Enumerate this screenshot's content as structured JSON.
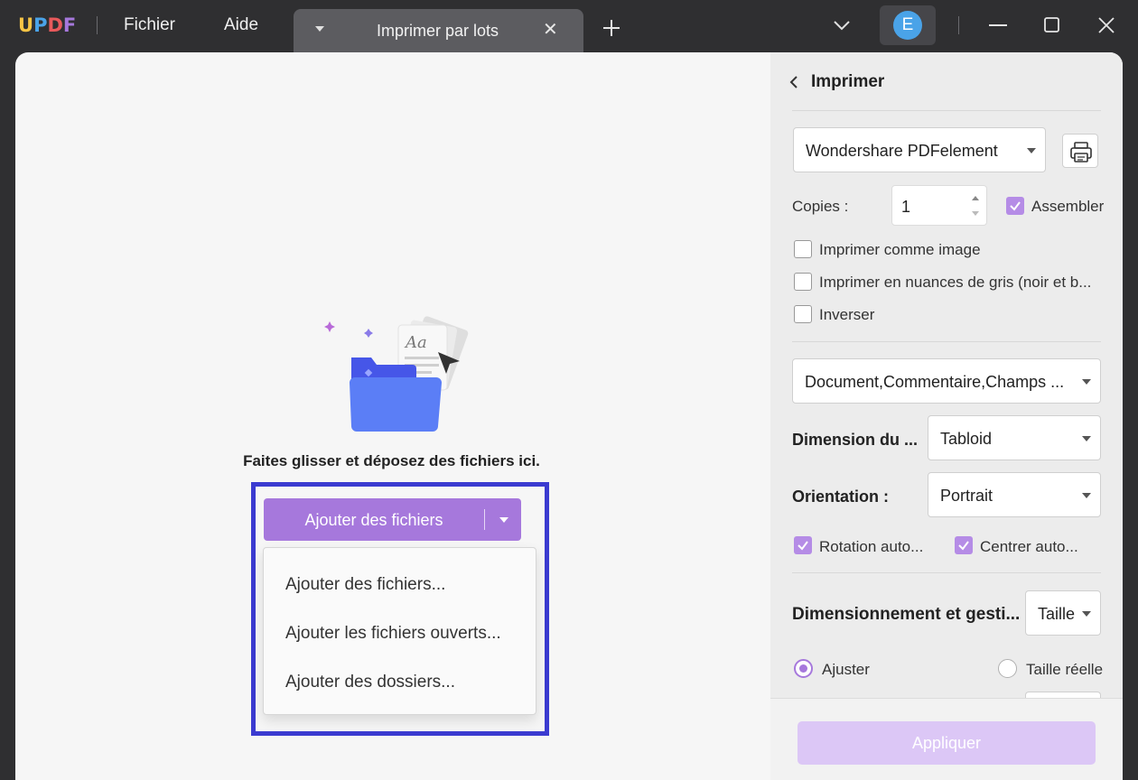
{
  "titlebar": {
    "logo": {
      "u": "U",
      "p": "P",
      "d": "D",
      "f": "F"
    },
    "menu": {
      "file": "Fichier",
      "help": "Aide"
    },
    "tab": {
      "title": "Imprimer par lots",
      "close": "✕"
    },
    "avatar_letter": "E"
  },
  "colors": {
    "accent": "#a678dc",
    "highlight_border": "#3b3bd0",
    "apply_disabled": "#dcc7f6",
    "logo_u": "#f6c445",
    "logo_p": "#4aa3e8",
    "logo_d": "#e8595b",
    "logo_f": "#a678dc"
  },
  "main": {
    "drop_text": "Faites glisser et déposez des fichiers ici.",
    "add_button": {
      "label": "Ajouter des fichiers"
    },
    "dropdown_items": [
      "Ajouter des fichiers...",
      "Ajouter les fichiers ouverts...",
      "Ajouter des dossiers..."
    ]
  },
  "panel": {
    "title": "Imprimer",
    "printer": "Wondershare PDFelement",
    "copies_label": "Copies :",
    "copies_value": "1",
    "collate_label": "Assembler",
    "options": [
      {
        "label": "Imprimer comme image",
        "checked": false
      },
      {
        "label": "Imprimer en nuances de gris (noir et b...",
        "checked": false
      },
      {
        "label": "Inverser",
        "checked": false
      }
    ],
    "content_select": "Document,Commentaire,Champs ...",
    "page_size_label": "Dimension du ...",
    "page_size_value": "Tabloid",
    "orientation_label": "Orientation :",
    "orientation_value": "Portrait",
    "auto_rotate_label": "Rotation auto...",
    "auto_center_label": "Centrer auto...",
    "sizing_label": "Dimensionnement et gesti...",
    "sizing_value": "Taille",
    "fit_label": "Ajuster",
    "actual_size_label": "Taille réelle",
    "apply_label": "Appliquer"
  }
}
